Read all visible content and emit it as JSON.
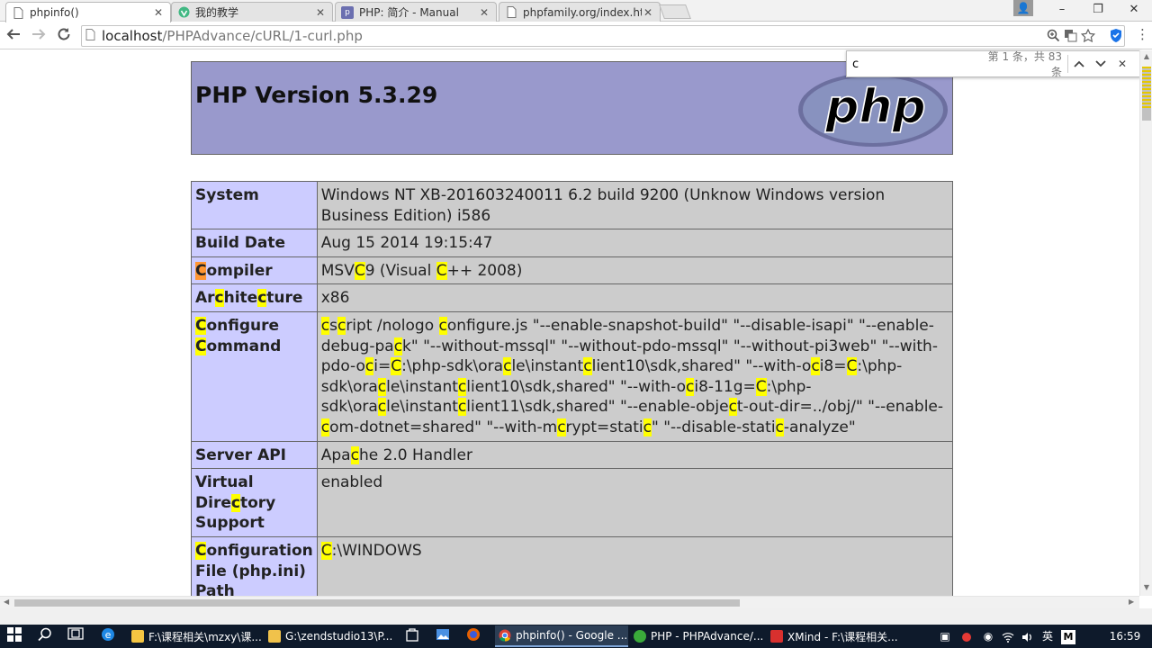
{
  "browser": {
    "tabs": [
      {
        "title": "phpinfo()",
        "active": true
      },
      {
        "title": "我的教学",
        "active": false
      },
      {
        "title": "PHP: 简介 - Manual",
        "active": false
      },
      {
        "title": "phpfamily.org/index.htm",
        "active": false
      }
    ],
    "window_controls": {
      "minimize": "–",
      "maximize": "❐",
      "close": "✕"
    },
    "address": {
      "host": "localhost",
      "path": "/PHPAdvance/cURL/1-curl.php"
    },
    "find": {
      "query": "c",
      "count": "第 1 条，共 83 条"
    }
  },
  "page": {
    "header": {
      "title": "PHP Version 5.3.29",
      "logo_text": "php"
    },
    "rows": [
      {
        "key": "System",
        "value": "Windows NT XB-201603240011 6.2 build 9200 (Unknow Windows version Business Edition) i586"
      },
      {
        "key": "Build Date",
        "value": "Aug 15 2014 19:15:47"
      },
      {
        "key": "Compiler",
        "value": "MSVC9 (Visual C++ 2008)"
      },
      {
        "key": "Architecture",
        "value": "x86"
      },
      {
        "key": "Configure Command",
        "value": "cscript /nologo configure.js \"--enable-snapshot-build\" \"--disable-isapi\" \"--enable-debug-pack\" \"--without-mssql\" \"--without-pdo-mssql\" \"--without-pi3web\" \"--with-pdo-oci=C:\\php-sdk\\oracle\\instantclient10\\sdk,shared\" \"--with-oci8=C:\\php-sdk\\oracle\\instantclient10\\sdk,shared\" \"--with-oci8-11g=C:\\php-sdk\\oracle\\instantclient11\\sdk,shared\" \"--enable-object-out-dir=../obj/\" \"--enable-com-dotnet=shared\" \"--with-mcrypt=static\" \"--disable-static-analyze\""
      },
      {
        "key": "Server API",
        "value": "Apache 2.0 Handler"
      },
      {
        "key": "Virtual Directory Support",
        "value": "enabled"
      },
      {
        "key": "Configuration File (php.ini) Path",
        "value": "C:\\WINDOWS"
      }
    ]
  },
  "taskbar": {
    "items": [
      {
        "label": "F:\\课程相关\\mzxy\\课...",
        "color": "#f4c542"
      },
      {
        "label": "G:\\zendstudio13\\P...",
        "color": "#f0c24b"
      },
      {
        "label": "phpinfo() - Google ...",
        "color": "#db4437"
      },
      {
        "label": "PHP - PHPAdvance/...",
        "color": "#3aa93a"
      },
      {
        "label": "XMind - F:\\课程相关...",
        "color": "#d8302e"
      }
    ],
    "ime": "英",
    "time": "16:59"
  },
  "colors": {
    "header_bg": "#9999cc",
    "key_bg": "#ccccff",
    "value_bg": "#cccccc",
    "find_highlight": "#ffff00",
    "find_current": "#ff9632"
  }
}
